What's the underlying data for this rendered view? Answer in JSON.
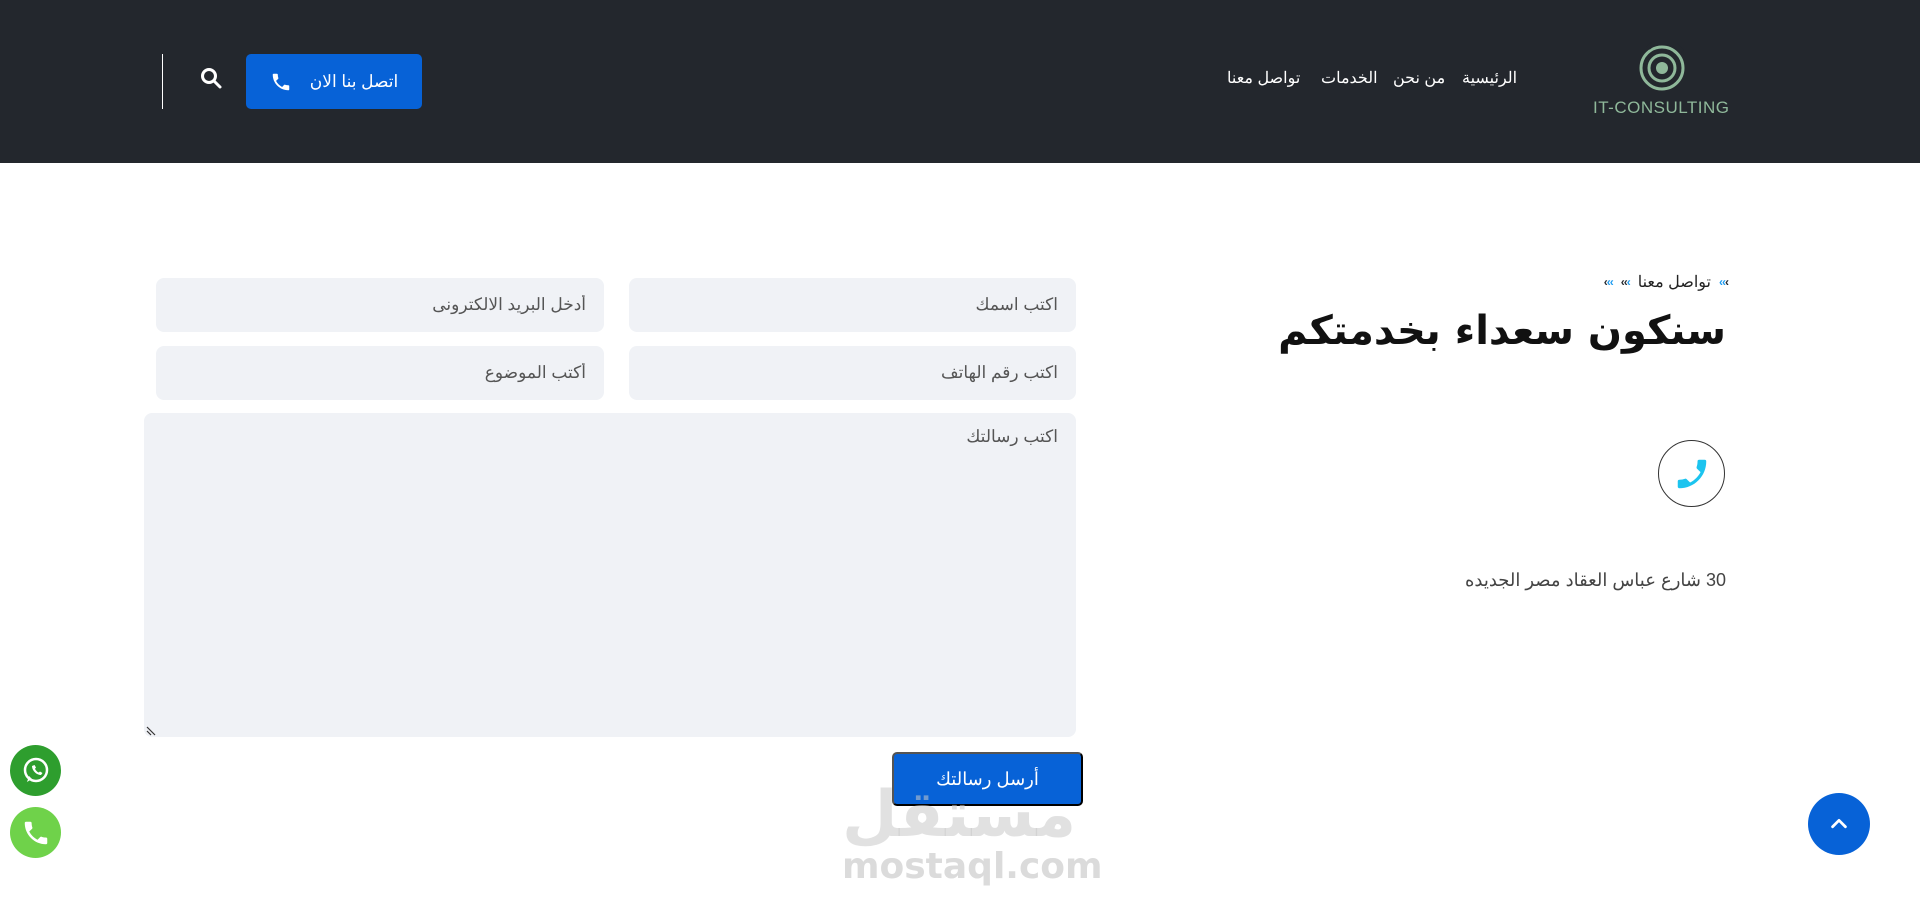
{
  "header": {
    "logo_text": "IT-CONSULTING",
    "nav": [
      {
        "label": "الرئيسية"
      },
      {
        "label": "من نحن"
      },
      {
        "label": "الخدمات"
      },
      {
        "label": "تواصل معنا"
      }
    ],
    "call_button_label": "اتصل بنا الان"
  },
  "contact": {
    "breadcrumb": "تواصل معنا",
    "title": "سنكون سعداء بخدمتكم",
    "address": "30 شارع عباس العقاد مصر الجديده"
  },
  "form": {
    "name_placeholder": "اكتب اسمك",
    "email_placeholder": "أدخل البريد الالكترونى",
    "phone_placeholder": "اكتب رقم الهاتف",
    "subject_placeholder": "أكتب الموضوع",
    "message_placeholder": "اكتب رسالتك",
    "submit_label": "أرسل رسالتك"
  },
  "watermark": {
    "arabic": "مستقل",
    "latin": "mostaql.com"
  },
  "colors": {
    "header_bg": "#23272d",
    "accent_blue": "#0762d7",
    "logo_green": "#8fb89a",
    "whatsapp_green": "#2e9e2e",
    "call_green": "#6fd24a",
    "field_bg": "#f0f2f6"
  }
}
